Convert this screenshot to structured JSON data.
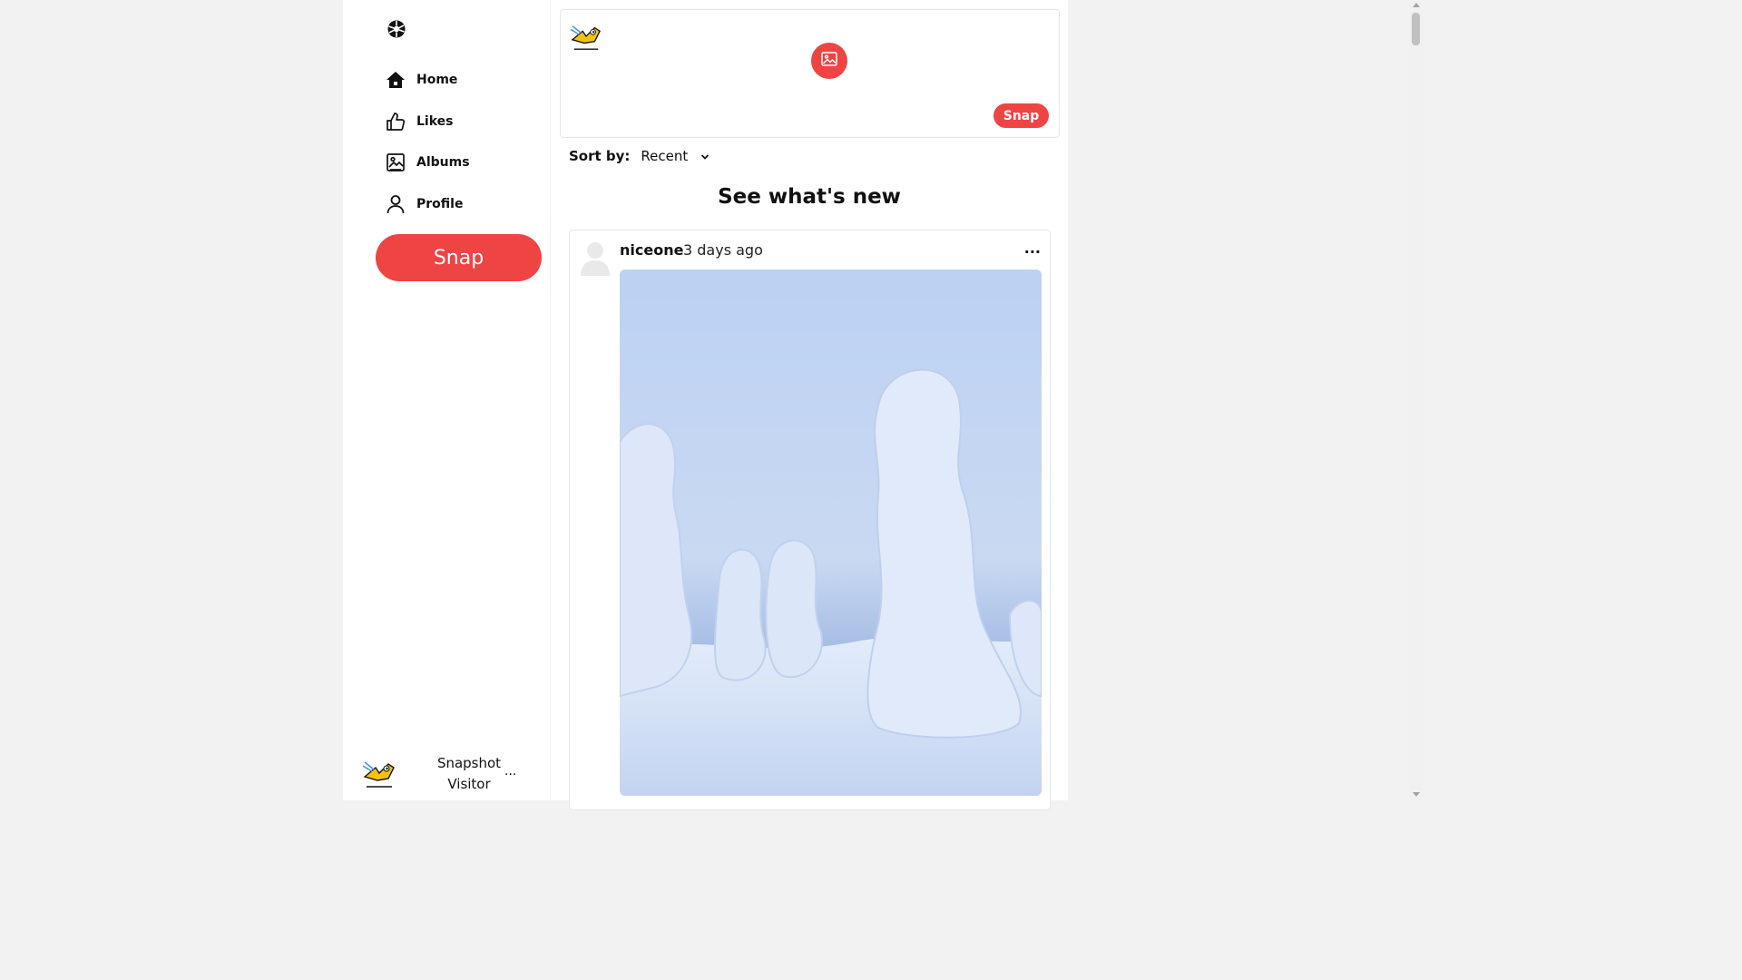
{
  "sidebar": {
    "logo_icon": "ball-logo-icon",
    "items": [
      {
        "label": "Home",
        "icon": "home-icon"
      },
      {
        "label": "Likes",
        "icon": "thumbs-up-icon"
      },
      {
        "label": "Albums",
        "icon": "image-album-icon"
      },
      {
        "label": "Profile",
        "icon": "user-icon"
      }
    ],
    "snap_button": "Snap",
    "user": {
      "name": "Snapshot Visitor",
      "more": "..."
    }
  },
  "composer": {
    "upload_icon": "image-upload-icon",
    "snap_button": "Snap"
  },
  "feed": {
    "sort_label": "Sort by:",
    "sort_value": "Recent",
    "title": "See what's new"
  },
  "post": {
    "username": "niceone",
    "time": "3 days ago",
    "more": "...",
    "image_subject": "snow-covered trees"
  },
  "colors": {
    "accent": "#ef4444",
    "background": "#f2f2f2",
    "surface": "#ffffff"
  }
}
